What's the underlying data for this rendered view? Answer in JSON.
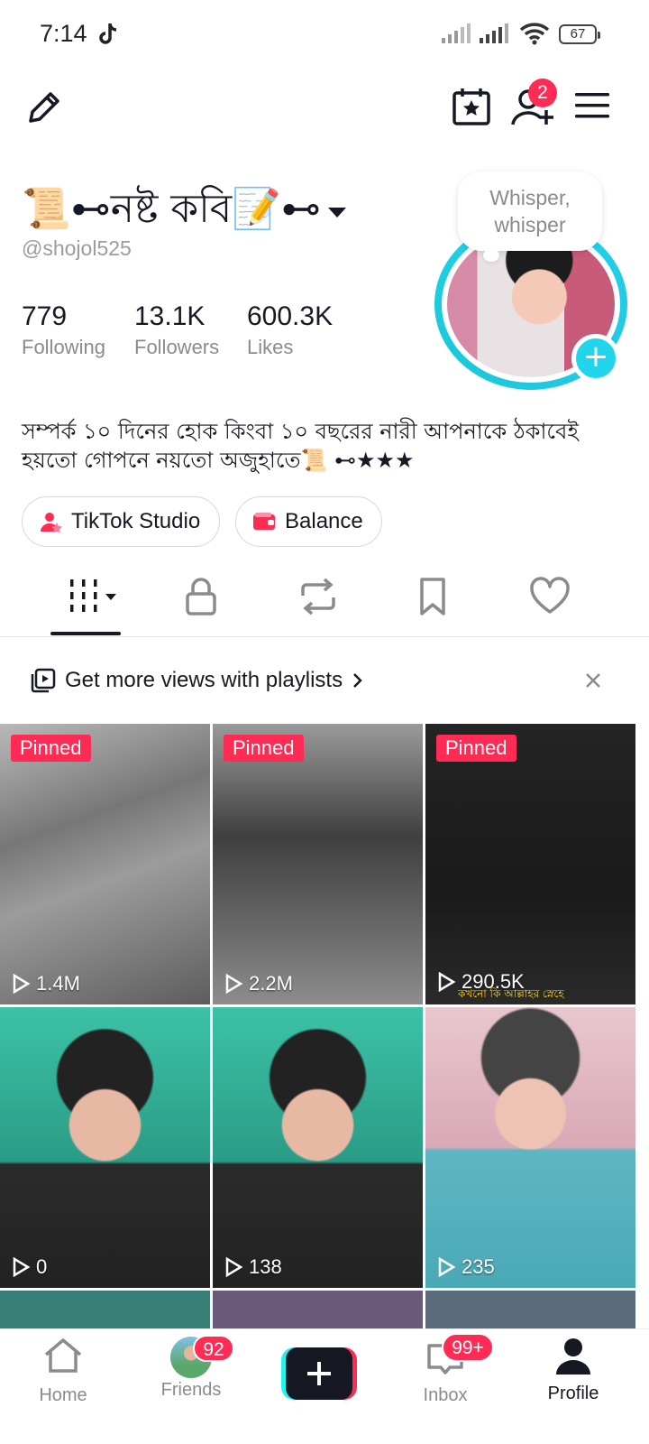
{
  "status_bar": {
    "time": "7:14",
    "battery": "67"
  },
  "top_bar": {
    "friend_requests_badge": "2"
  },
  "profile": {
    "display_name": "📜⊷নষ্ট কবি📝⊷",
    "handle": "@shojol525",
    "status_bubble": "Whisper, whisper",
    "stats": [
      {
        "value": "779",
        "label": "Following"
      },
      {
        "value": "13.1K",
        "label": "Followers"
      },
      {
        "value": "600.3K",
        "label": "Likes"
      }
    ],
    "bio_line1": "সম্পর্ক ১০ দিনের হোক কিংবা ১০ বছরের নারী আপনাকে ঠকাবেই",
    "bio_line2": "হয়তো গোপনে নয়তো অজুহাতে📜 ⊷★★★",
    "buttons": {
      "studio": "TikTok Studio",
      "balance": "Balance"
    }
  },
  "playlist_banner": {
    "text": "Get more views with playlists"
  },
  "videos": [
    {
      "pinned": "Pinned",
      "views": "1.4M",
      "bg": "#8a8a8a"
    },
    {
      "pinned": "Pinned",
      "views": "2.2M",
      "bg": "#555555"
    },
    {
      "pinned": "Pinned",
      "views": "290.5K",
      "bg": "#1e1e1e",
      "caption": "কখনো কি আল্লাহর স্নেহে"
    },
    {
      "pinned": "",
      "views": "0",
      "bg": "#2fa58f"
    },
    {
      "pinned": "",
      "views": "138",
      "bg": "#2b9f8a"
    },
    {
      "pinned": "",
      "views": "235",
      "bg": "#5fb6c2"
    }
  ],
  "bottom_nav": {
    "home": "Home",
    "friends": "Friends",
    "friends_badge": "92",
    "inbox": "Inbox",
    "inbox_badge": "99+",
    "profile": "Profile"
  },
  "colors": {
    "accent": "#fe2c55",
    "cyan": "#20d5ec",
    "text": "#161823",
    "muted": "#8a8b91"
  }
}
